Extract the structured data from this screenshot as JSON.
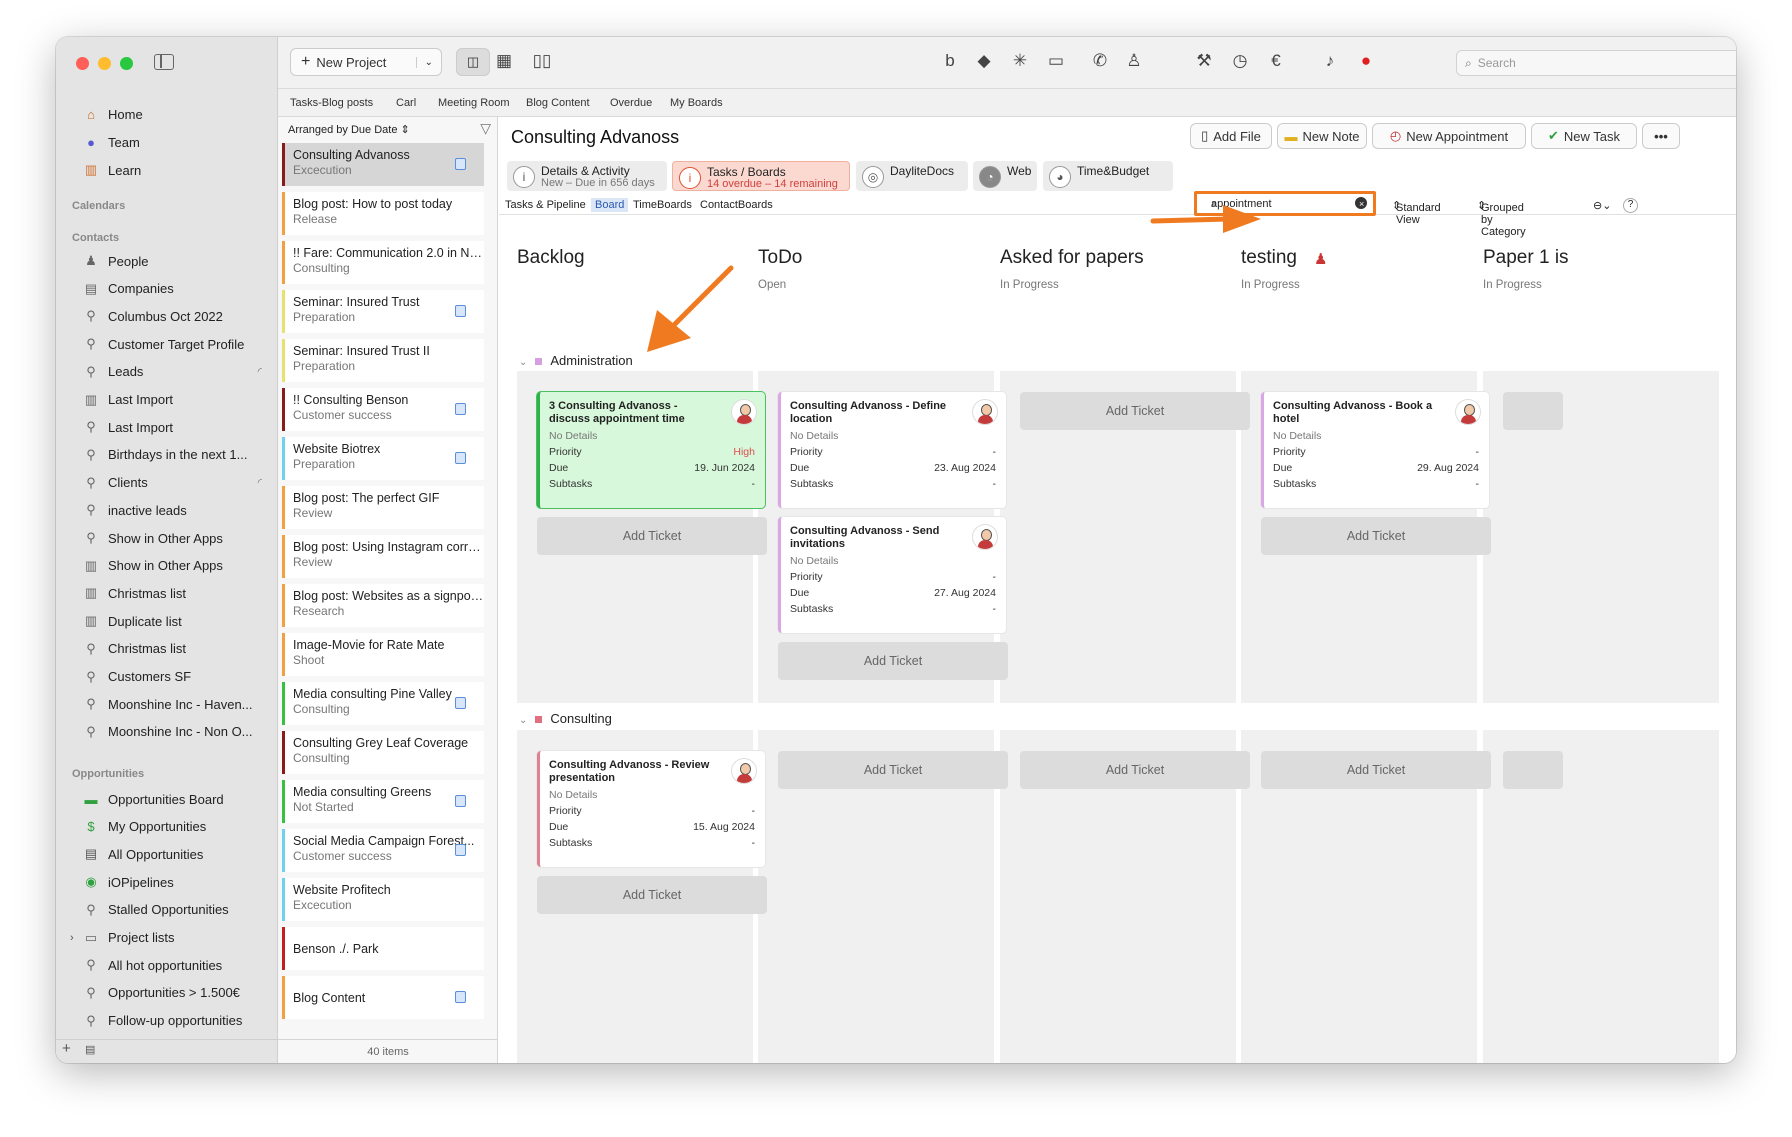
{
  "sidebar": {
    "items_top": [
      {
        "label": "Home",
        "icon": "home-icon"
      },
      {
        "label": "Team",
        "icon": "team-icon"
      },
      {
        "label": "Learn",
        "icon": "learn-icon"
      }
    ],
    "calendars_heading": "Calendars",
    "contacts_heading": "Contacts",
    "contacts": [
      "People",
      "Companies",
      "Columbus Oct 2022",
      "Customer Target Profile",
      "Leads",
      "Last Import",
      "Last Import",
      "Birthdays in the next 1...",
      "Clients",
      "inactive leads",
      "Show in Other Apps",
      "Show in Other Apps",
      "Christmas list",
      "Duplicate list",
      "Christmas list",
      "Customers SF",
      "Moonshine Inc - Haven...",
      "Moonshine Inc - Non O..."
    ],
    "opportunities_heading": "Opportunities",
    "opportunities": [
      "Opportunities Board",
      "My Opportunities",
      "All Opportunities",
      "iOPipelines",
      "Stalled Opportunities",
      "Project lists",
      "All hot opportunities",
      "Opportunities > 1.500€",
      "Follow-up opportunities"
    ]
  },
  "toolbar": {
    "new_project": "New Project",
    "search_placeholder": "Search"
  },
  "tabs": [
    "Tasks-Blog posts",
    "Carl",
    "Meeting Room",
    "Blog Content",
    "Overdue",
    "My Boards"
  ],
  "list": {
    "sort_label": "Arranged by Due Date",
    "footer": "40 items",
    "items": [
      {
        "title": "Consulting Advanoss",
        "sub": "Excecution",
        "color": "#8b1a1a",
        "board": true
      },
      {
        "title": "Blog post: How to post today",
        "sub": "Release",
        "color": "#f0a040",
        "board": false
      },
      {
        "title": "!! Fare: Communication 2.0 in New...",
        "sub": "Consulting",
        "color": "#f0a040",
        "board": false
      },
      {
        "title": "Seminar: Insured Trust",
        "sub": "Preparation",
        "color": "#e8e070",
        "board": true
      },
      {
        "title": "Seminar: Insured Trust II",
        "sub": "Preparation",
        "color": "#e8e070",
        "board": false
      },
      {
        "title": "!! Consulting Benson",
        "sub": "Customer success",
        "color": "#8b1a1a",
        "board": true
      },
      {
        "title": "Website Biotrex",
        "sub": "Preparation",
        "color": "#70d0f0",
        "board": true
      },
      {
        "title": "Blog post: The perfect GIF",
        "sub": "Review",
        "color": "#f0a040",
        "board": false
      },
      {
        "title": "Blog post: Using Instagram correctly",
        "sub": "Review",
        "color": "#f0a040",
        "board": false
      },
      {
        "title": "Blog post: Websites as a signpost f...",
        "sub": "Research",
        "color": "#f0a040",
        "board": false
      },
      {
        "title": "Image-Movie for Rate Mate",
        "sub": "Shoot",
        "color": "#f0a040",
        "board": false
      },
      {
        "title": "Media consulting Pine Valley",
        "sub": "Consulting",
        "color": "#3ac040",
        "board": true
      },
      {
        "title": "Consulting Grey Leaf Coverage",
        "sub": "Consulting",
        "color": "#8b1a1a",
        "board": false
      },
      {
        "title": "Media consulting Greens",
        "sub": "Not Started",
        "color": "#3ac040",
        "board": true
      },
      {
        "title": "Social Media Campaign Forest...",
        "sub": "Customer success",
        "color": "#70d0f0",
        "board": true
      },
      {
        "title": "Website Profitech",
        "sub": "Excecution",
        "color": "#70d0f0",
        "board": false
      },
      {
        "title": "Benson ./. Park",
        "sub": "",
        "color": "#c02020",
        "board": false
      },
      {
        "title": "Blog Content",
        "sub": "",
        "color": "#f0a040",
        "board": true
      }
    ]
  },
  "main": {
    "title": "Consulting Advanoss",
    "actions": {
      "add_file": "Add File",
      "new_note": "New Note",
      "new_appointment": "New Appointment",
      "new_task": "New Task"
    },
    "content_tabs": [
      {
        "l1": "Details & Activity",
        "l2": "New – Due in 656 days"
      },
      {
        "l1": "Tasks / Boards",
        "l2": "14 overdue – 14 remaining"
      },
      {
        "l1": "DayliteDocs",
        "l2": ""
      },
      {
        "l1": "Web",
        "l2": ""
      },
      {
        "l1": "Time&Budget",
        "l2": ""
      }
    ],
    "subtabs": [
      "Tasks & Pipeline",
      "Board",
      "TimeBoards",
      "ContactBoards"
    ],
    "filter_value": "appointment",
    "view": "Standard View",
    "grouping": "Grouped by Category",
    "help": "?",
    "columns": [
      {
        "title": "Backlog",
        "sub": ""
      },
      {
        "title": "ToDo",
        "sub": "Open"
      },
      {
        "title": "Asked for papers",
        "sub": "In Progress"
      },
      {
        "title": "testing",
        "sub": "In Progress"
      },
      {
        "title": "Paper 1 is",
        "sub": "In Progress"
      }
    ],
    "groups": [
      "Administration",
      "Consulting"
    ],
    "add_ticket": "Add Ticket",
    "cards": [
      {
        "title": "3 Consulting Advanoss - discuss appointment time",
        "details": "No Details",
        "priority_label": "Priority",
        "priority": "High",
        "due_label": "Due",
        "due": "19. Jun 2024",
        "subtasks_label": "Subtasks",
        "subtasks": "-"
      },
      {
        "title": "Consulting Advanoss - Define location",
        "details": "No Details",
        "priority_label": "Priority",
        "priority": "-",
        "due_label": "Due",
        "due": "23. Aug 2024",
        "subtasks_label": "Subtasks",
        "subtasks": "-"
      },
      {
        "title": "Consulting Advanoss - Send invitations",
        "details": "No Details",
        "priority_label": "Priority",
        "priority": "-",
        "due_label": "Due",
        "due": "27. Aug 2024",
        "subtasks_label": "Subtasks",
        "subtasks": "-"
      },
      {
        "title": "Consulting Advanoss - Book a hotel",
        "details": "No Details",
        "priority_label": "Priority",
        "priority": "-",
        "due_label": "Due",
        "due": "29. Aug 2024",
        "subtasks_label": "Subtasks",
        "subtasks": "-"
      },
      {
        "title": "Consulting Advanoss - Review presentation",
        "details": "No Details",
        "priority_label": "Priority",
        "priority": "-",
        "due_label": "Due",
        "due": "15. Aug 2024",
        "subtasks_label": "Subtasks",
        "subtasks": "-"
      }
    ]
  }
}
